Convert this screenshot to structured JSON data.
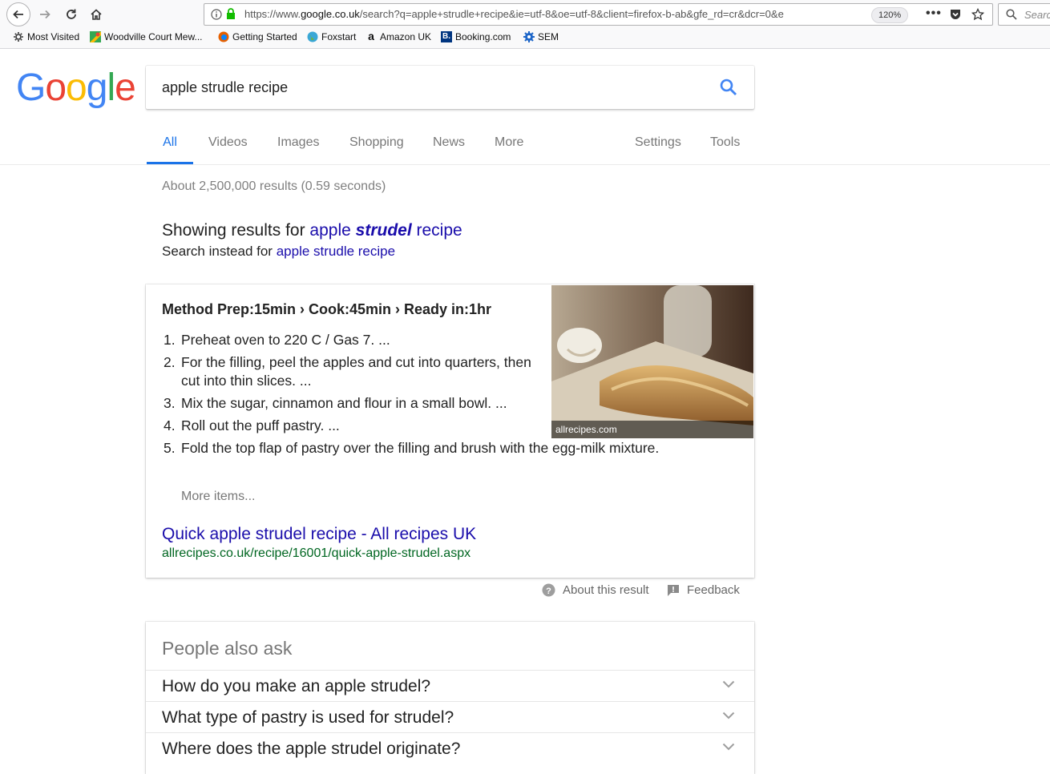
{
  "browser": {
    "url_prefix": "https://www.",
    "url_host": "google.co.uk",
    "url_rest": "/search?q=apple+strudle+recipe&ie=utf-8&oe=utf-8&client=firefox-b-ab&gfe_rd=cr&dcr=0&e",
    "zoom": "120%",
    "search_placeholder": "Search",
    "bookmarks": [
      "Most Visited",
      "Woodville Court Mew...",
      "Getting Started",
      "Foxstart",
      "Amazon UK",
      "Booking.com",
      "SEM"
    ]
  },
  "google": {
    "logo_letters": [
      "G",
      "o",
      "o",
      "g",
      "l",
      "e"
    ],
    "logo_colors": [
      "#4285F4",
      "#EA4335",
      "#FBBC05",
      "#4285F4",
      "#34A853",
      "#EA4335"
    ],
    "query": "apple strudle recipe",
    "tabs": [
      "All",
      "Videos",
      "Images",
      "Shopping",
      "News",
      "More"
    ],
    "tools": [
      "Settings",
      "Tools"
    ],
    "result_stats": "About 2,500,000 results (0.59 seconds)",
    "showing_prefix": "Showing results for ",
    "showing_q_pre": "apple ",
    "showing_q_bold": "strudel",
    "showing_q_post": " recipe",
    "instead_prefix": "Search instead for ",
    "instead_query": "apple strudle recipe",
    "snippet": {
      "heading": "Method Prep:15min › Cook:45min › Ready in:1hr",
      "steps": [
        "Preheat oven to 220 C / Gas 7. ...",
        "For the filling, peel the apples and cut into quarters, then cut into thin slices. ...",
        "Mix the sugar, cinnamon and flour in a small bowl. ...",
        "Roll out the puff pastry. ...",
        "Fold the top flap of pastry over the filling and brush with the egg-milk mixture."
      ],
      "image_caption": "allrecipes.com",
      "more_items": "More items...",
      "result_title": "Quick apple strudel recipe - All recipes UK",
      "result_url": "allrecipes.co.uk/recipe/16001/quick-apple-strudel.aspx"
    },
    "about_result": "About this result",
    "feedback": "Feedback",
    "people_also_ask": {
      "title": "People also ask",
      "questions": [
        "How do you make an apple strudel?",
        "What type of pastry is used for strudel?",
        "Where does the apple strudel originate?"
      ]
    }
  }
}
